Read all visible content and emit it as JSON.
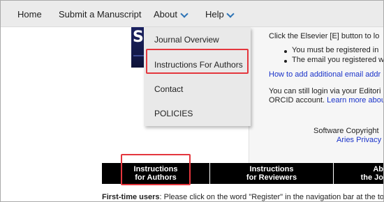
{
  "nav": {
    "home": "Home",
    "submit": "Submit a Manuscript",
    "about": "About",
    "help": "Help"
  },
  "cover": {
    "letter": "S"
  },
  "dropdown": {
    "items": [
      {
        "label": "Journal Overview"
      },
      {
        "label": "Instructions For Authors"
      },
      {
        "label": "Contact"
      },
      {
        "label": "POLICIES"
      }
    ]
  },
  "panel": {
    "intro": "Click the Elsevier [E] button to lo",
    "bullet1": "You must be registered in",
    "bullet2": "The email you registered w",
    "email_link": "How to add additional email addr",
    "editorial_line1": "You can still login via your Editori",
    "editorial_line2_a": "ORCID account.",
    "editorial_line2_link": "Learn more abou",
    "copyright": "Software Copyright",
    "privacy": "Aries Privacy"
  },
  "tabs": [
    {
      "line1": "Instructions",
      "line2": "for Authors"
    },
    {
      "line1": "Instructions",
      "line2": "for Reviewers"
    },
    {
      "line1": "Ab",
      "line2": "the Jo"
    }
  ],
  "bottom": {
    "bold": "First-time users",
    "rest": ": Please click on the word \"Register\" in the navigation bar at the top"
  },
  "colors": {
    "annotation": "#e4363d",
    "link": "#1a33c9",
    "chevron": "#2a72b5"
  }
}
